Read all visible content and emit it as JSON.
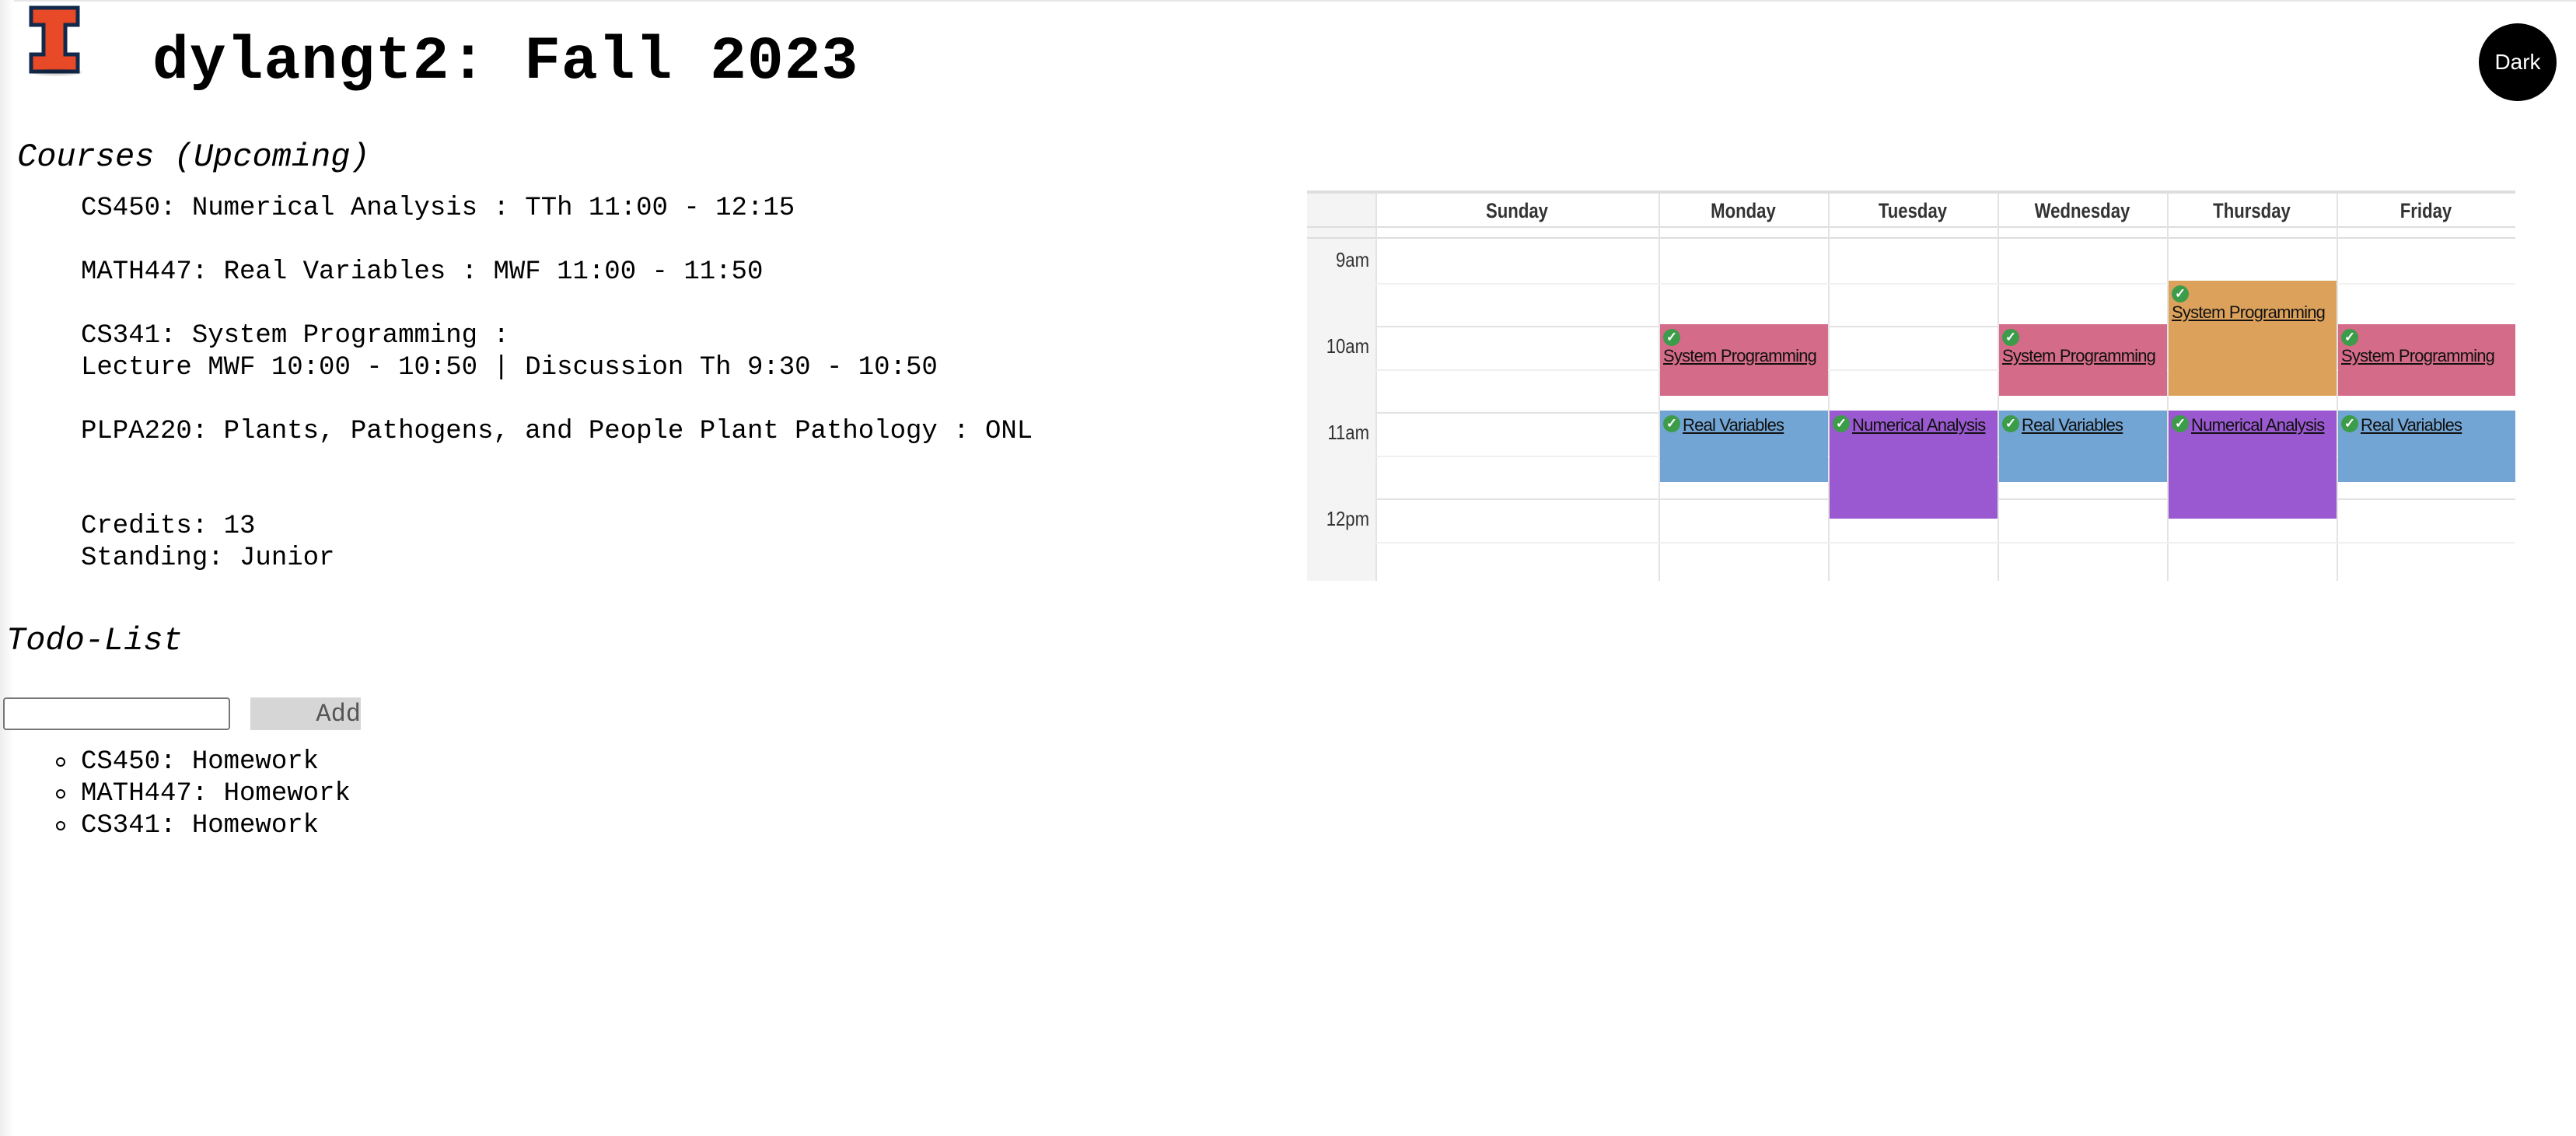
{
  "header": {
    "title": "dylangt2: Fall 2023",
    "theme_toggle_label": "Dark"
  },
  "courses": {
    "heading": "Courses (Upcoming)",
    "items": [
      "CS450: Numerical Analysis : TTh 11:00 - 12:15",
      "MATH447: Real Variables : MWF 11:00 - 11:50",
      "CS341: System Programming :",
      "Lecture MWF 10:00 - 10:50 | Discussion Th 9:30 - 10:50",
      "PLPA220: Plants, Pathogens, and People Plant Pathology : ONL"
    ],
    "credits": "Credits: 13",
    "standing": "Standing: Junior"
  },
  "calendar": {
    "days": [
      "Sunday",
      "Monday",
      "Tuesday",
      "Wednesday",
      "Thursday",
      "Friday"
    ],
    "times": [
      "9am",
      "10am",
      "11am",
      "12pm"
    ],
    "events": [
      {
        "title": "System Programming",
        "day": "Monday",
        "start": "10:00",
        "end": "10:50"
      },
      {
        "title": "System Programming",
        "day": "Wednesday",
        "start": "10:00",
        "end": "10:50"
      },
      {
        "title": "System Programming",
        "day": "Thursday",
        "start": "9:30",
        "end": "10:50"
      },
      {
        "title": "System Programming",
        "day": "Friday",
        "start": "10:00",
        "end": "10:50"
      },
      {
        "title": "Real Variables",
        "day": "Monday",
        "start": "11:00",
        "end": "11:50"
      },
      {
        "title": "Real Variables",
        "day": "Wednesday",
        "start": "11:00",
        "end": "11:50"
      },
      {
        "title": "Real Variables",
        "day": "Friday",
        "start": "11:00",
        "end": "11:50"
      },
      {
        "title": "Numerical Analysis",
        "day": "Tuesday",
        "start": "11:00",
        "end": "12:15"
      },
      {
        "title": "Numerical Analysis",
        "day": "Thursday",
        "start": "11:00",
        "end": "12:15"
      }
    ],
    "colors": {
      "system_programming": "#d46b88",
      "system_programming_thursday": "#dca25c",
      "real_variables": "#72a5d3",
      "numerical_analysis": "#9a59d0"
    }
  },
  "todo": {
    "heading": "Todo-List",
    "input_value": "",
    "add_label": "Add",
    "items": [
      "CS450: Homework",
      "MATH447: Homework",
      "CS341: Homework"
    ]
  },
  "icons": {
    "logo": "illinois-block-i-logo",
    "event_check": "check-circle-icon",
    "list_bullet": "circle-bullet-icon"
  },
  "brand_color": "#e84a27"
}
